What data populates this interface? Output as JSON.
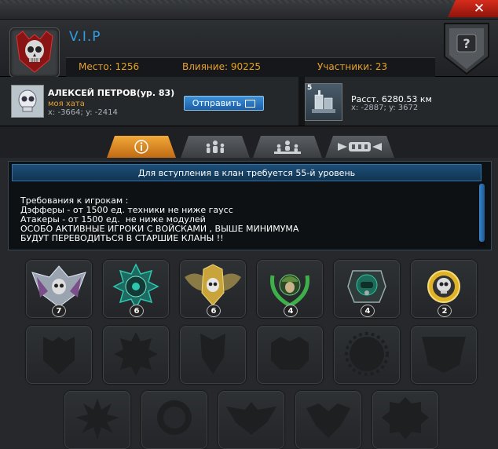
{
  "window": {
    "close_label": "✕"
  },
  "clan": {
    "name": "V.I.P",
    "stats": {
      "place_label": "Место:",
      "place_value": "1256",
      "influence_label": "Влияние:",
      "influence_value": "90225",
      "members_label": "Участники:",
      "members_value": "23"
    }
  },
  "player": {
    "name": "АЛЕКСЕЙ ПЕТРОВ(ур. 83)",
    "status": "моя хата",
    "coords": "x: -3664; y: -2414",
    "send_label": "Отправить"
  },
  "base": {
    "level": "5",
    "distance": "Расст. 6280.53 км",
    "coords": "x: -2887; y: 3672"
  },
  "tabs": [
    {
      "icon": "info-icon",
      "active": true
    },
    {
      "icon": "members-icon",
      "active": false
    },
    {
      "icon": "ranks-icon",
      "active": false
    },
    {
      "icon": "emblems-icon",
      "active": false
    }
  ],
  "requirements": {
    "title": "Для вступления в клан требуется 55-й уровень",
    "text": "Требования к игрокам :\nДэфферы - от 1500 ед. техники не ниже гаусс\nАтакеры - от 1500 ед.  не ниже модулей\nОСОБО АКТИВНЫЕ ИГРОКИ С ВОЙСКАМИ , ВЫШЕ МИНИМУМА\nБУДУТ ПЕРЕВОДИТЬСЯ В СТАРШИЕ КЛАНЫ !!"
  },
  "achievements": [
    {
      "icon": "winged-skull-medal-icon",
      "count": "7",
      "color": "#9aa4b0"
    },
    {
      "icon": "gear-star-medal-icon",
      "count": "6",
      "color": "#2fc6b0"
    },
    {
      "icon": "winged-skull-gold-icon",
      "count": "6",
      "color": "#c9a43a"
    },
    {
      "icon": "soldier-wreath-icon",
      "count": "4",
      "color": "#3db04a"
    },
    {
      "icon": "gasmask-shield-icon",
      "count": "4",
      "color": "#2fc6a0"
    },
    {
      "icon": "gold-skull-icon",
      "count": "2",
      "color": "#e0b22a"
    }
  ],
  "locked_slots": [
    {
      "icon": "locked-shield-icon"
    },
    {
      "icon": "locked-star-icon"
    },
    {
      "icon": "locked-crest-icon"
    },
    {
      "icon": "locked-round-badge-icon"
    },
    {
      "icon": "locked-sun-icon"
    },
    {
      "icon": "locked-banner-icon"
    },
    {
      "icon": "locked-burst-icon"
    },
    {
      "icon": "locked-wreath-icon"
    },
    {
      "icon": "locked-wings-icon"
    },
    {
      "icon": "locked-eagle-icon"
    },
    {
      "icon": "locked-cog-icon"
    }
  ]
}
